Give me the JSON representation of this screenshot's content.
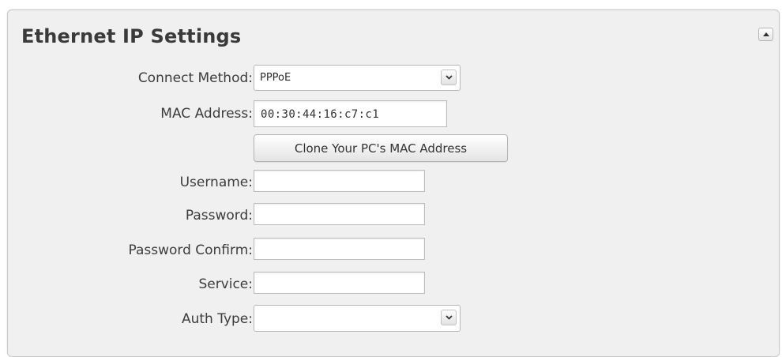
{
  "panel": {
    "title": "Ethernet IP Settings"
  },
  "form": {
    "connect_method": {
      "label": "Connect Method:",
      "value": "PPPoE"
    },
    "mac_address": {
      "label": "MAC Address:",
      "value": "00:30:44:16:c7:c1"
    },
    "clone_button": "Clone Your PC's MAC Address",
    "username": {
      "label": "Username:",
      "value": ""
    },
    "password": {
      "label": "Password:",
      "value": ""
    },
    "password_confirm": {
      "label": "Password Confirm:",
      "value": ""
    },
    "service": {
      "label": "Service:",
      "value": ""
    },
    "auth_type": {
      "label": "Auth Type:",
      "value": ""
    }
  },
  "icons": {
    "collapse": "collapse-up-icon",
    "dropdown": "chevron-down-icon"
  }
}
